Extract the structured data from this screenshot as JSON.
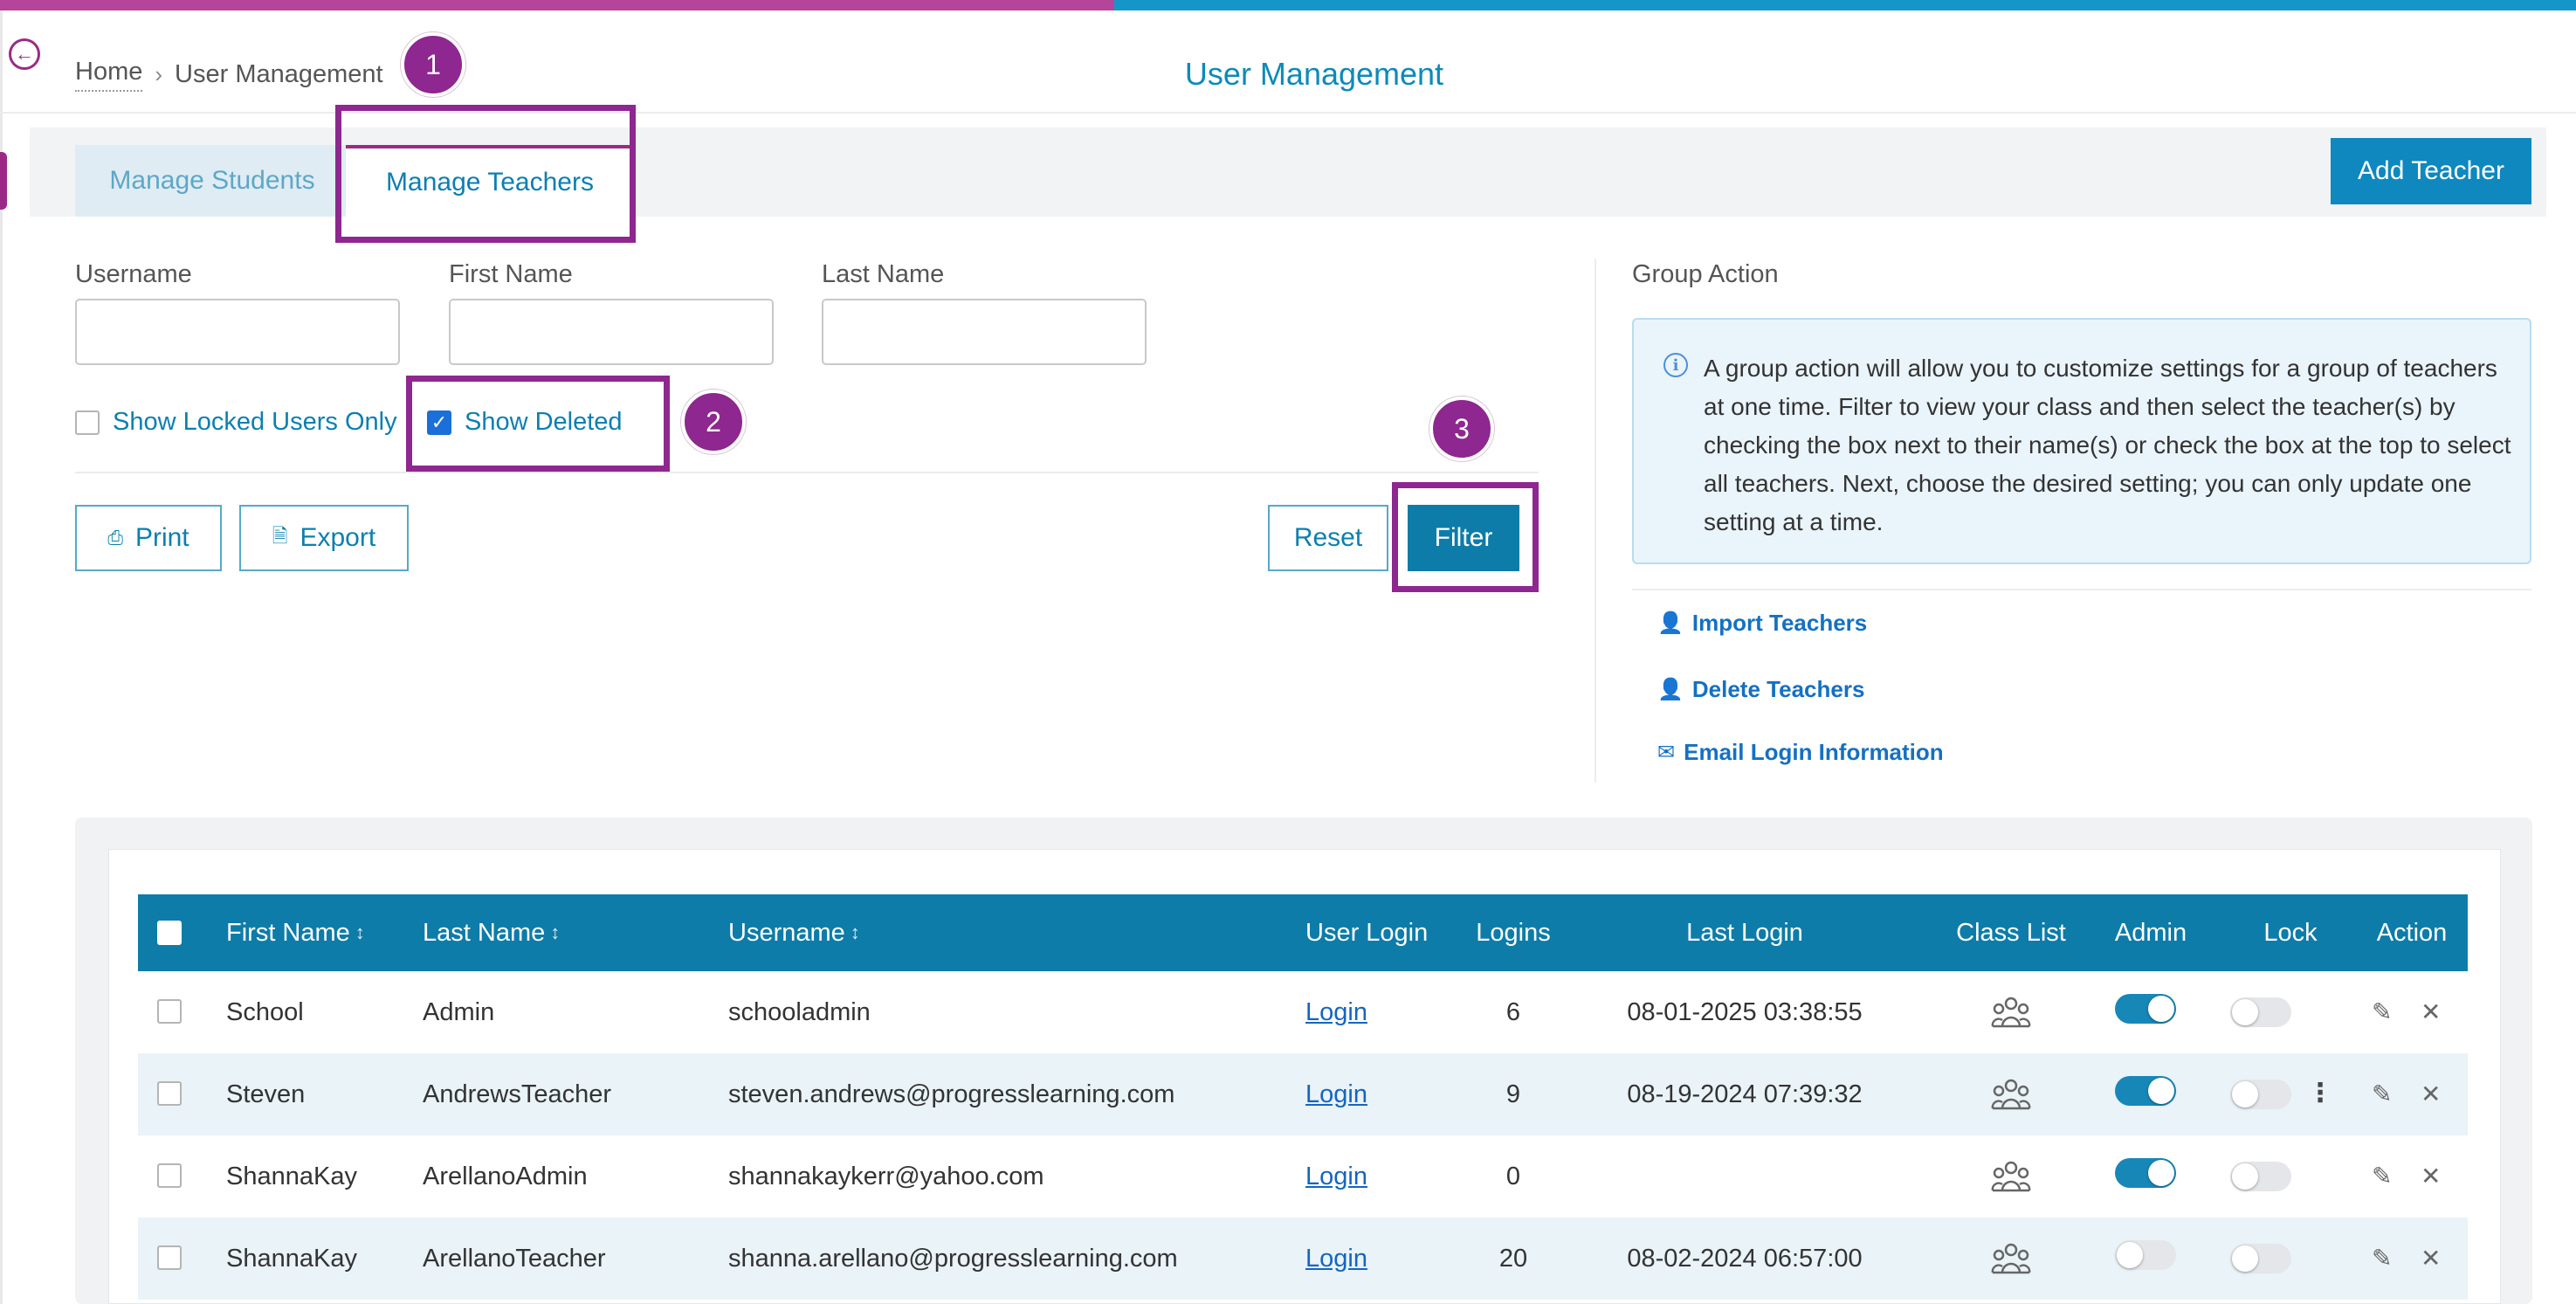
{
  "breadcrumb": {
    "home": "Home",
    "separator": "›",
    "current": "User Management"
  },
  "page_title": "User Management",
  "tabs": [
    {
      "label": "Manage Students",
      "active": false
    },
    {
      "label": "Manage Teachers",
      "active": true
    }
  ],
  "add_teacher_label": "Add Teacher",
  "filters": {
    "username_label": "Username",
    "first_name_label": "First Name",
    "last_name_label": "Last Name",
    "username_value": "",
    "first_name_value": "",
    "last_name_value": "",
    "show_locked_label": "Show Locked Users Only",
    "show_locked_checked": false,
    "show_deleted_label": "Show Deleted",
    "show_deleted_checked": true
  },
  "buttons": {
    "print": "Print",
    "export": "Export",
    "reset": "Reset",
    "filter": "Filter"
  },
  "annotations": [
    "1",
    "2",
    "3"
  ],
  "group_action": {
    "title": "Group Action",
    "info": "A group action will allow you to customize settings for a group of teachers at one time. Filter to view your class and then select the teacher(s) by checking the box next to their name(s) or check the box at the top to select all teachers. Next, choose the desired setting; you can only update one setting at a time.",
    "links": [
      {
        "label": "Import Teachers",
        "icon": "user-plus-icon"
      },
      {
        "label": "Delete Teachers",
        "icon": "user-minus-icon"
      },
      {
        "label": "Email Login Information",
        "icon": "envelope-icon"
      }
    ]
  },
  "table": {
    "headers": {
      "first_name": "First Name",
      "last_name": "Last Name",
      "username": "Username",
      "user_login": "User Login",
      "logins": "Logins",
      "last_login": "Last Login",
      "class_list": "Class List",
      "admin": "Admin",
      "lock": "Lock",
      "action": "Action"
    },
    "sort_glyph": "↕",
    "login_link": "Login",
    "rows": [
      {
        "first_name": "School",
        "last_name": "Admin",
        "username": "schooladmin",
        "logins": "6",
        "last_login": "08-01-2025 03:38:55",
        "admin": true,
        "lock": false
      },
      {
        "first_name": "Steven",
        "last_name": "AndrewsTeacher",
        "username": "steven.andrews@progresslearning.com",
        "logins": "9",
        "last_login": "08-19-2024 07:39:32",
        "admin": true,
        "lock": false
      },
      {
        "first_name": "ShannaKay",
        "last_name": "ArellanoAdmin",
        "username": "shannakaykerr@yahoo.com",
        "logins": "0",
        "last_login": "",
        "admin": true,
        "lock": false
      },
      {
        "first_name": "ShannaKay",
        "last_name": "ArellanoTeacher",
        "username": "shanna.arellano@progresslearning.com",
        "logins": "20",
        "last_login": "08-02-2024 06:57:00",
        "admin": false,
        "lock": false
      }
    ]
  },
  "colors": {
    "brand_purple": "#9b2a86",
    "brand_blue": "#0d7ca8",
    "link_blue": "#1565c0",
    "annotation": "#8e278f"
  }
}
